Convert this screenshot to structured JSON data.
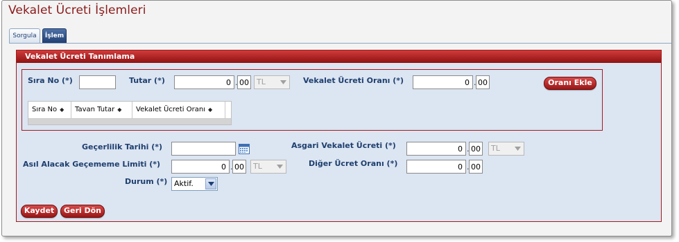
{
  "page": {
    "title": "Vekalet Ücreti İşlemleri"
  },
  "tabs": [
    {
      "label": "Sorgula"
    },
    {
      "label": "İşlem"
    }
  ],
  "panel": {
    "title": "Vekalet Ücreti Tanımlama"
  },
  "inner": {
    "sira_no_label": "Sıra No (*)",
    "sira_no_value": "",
    "tutar_label": "Tutar (*)",
    "tutar_whole": "0",
    "tutar_decimal": "00",
    "tutar_currency": "TL",
    "oran_label": "Vekalet Ücreti Oranı (*)",
    "oran_whole": "0",
    "oran_decimal": "00",
    "add_button": "Oranı Ekle",
    "grid_columns": [
      "Sıra No",
      "Tavan Tutar",
      "Vekalet Ücreti Oranı"
    ]
  },
  "form": {
    "gecerlilik_label": "Geçerlilik Tarihi (*)",
    "gecerlilik_value": "",
    "asil_alacak_label": "Asıl Alacak Geçememe Limiti (*)",
    "asil_alacak_whole": "0",
    "asil_alacak_decimal": "00",
    "asil_alacak_currency": "TL",
    "durum_label": "Durum (*)",
    "durum_value": "Aktif.",
    "asgari_label": "Asgari Vekalet Ücreti (*)",
    "asgari_whole": "0",
    "asgari_decimal": "00",
    "asgari_currency": "TL",
    "diger_label": "Diğer Ücret Oranı (*)",
    "diger_whole": "0",
    "diger_decimal": "00"
  },
  "actions": {
    "save": "Kaydet",
    "back": "Geri Dön"
  },
  "colors": {
    "title": "#8b1a1a",
    "accent": "#a21b1b",
    "panel_bg": "#dce5f2",
    "label": "#1e3f6e"
  },
  "icons": {
    "calendar": "calendar-icon",
    "sort": "sort-icon",
    "dropdown": "chevron-down-icon"
  }
}
